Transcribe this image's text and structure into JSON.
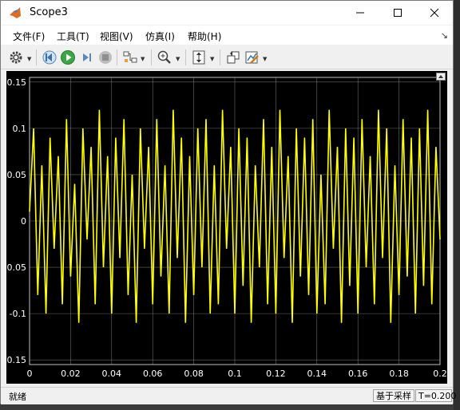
{
  "window": {
    "title": "Scope3"
  },
  "menu": [
    "文件(F)",
    "工具(T)",
    "视图(V)",
    "仿真(I)",
    "帮助(H)"
  ],
  "toolbar_icons": [
    "settings-icon",
    "step-back-icon",
    "run-icon",
    "step-forward-icon",
    "stop-icon",
    "highlight-block-icon",
    "zoom-in-icon",
    "autoscale-icon",
    "restore-layout-icon",
    "edit-style-icon"
  ],
  "status": {
    "ready": "就绪",
    "mode": "基于采样",
    "time": "T=0.200"
  },
  "colors": {
    "trace": "#ffff00",
    "background": "#000000",
    "grid": "#bfbfbf",
    "axis_text": "#ffffff"
  },
  "chart_data": {
    "type": "line",
    "title": "",
    "xlabel": "",
    "ylabel": "",
    "xlim": [
      0,
      0.2
    ],
    "ylim": [
      -0.155,
      0.155
    ],
    "xticks": [
      0,
      0.02,
      0.04,
      0.06,
      0.08,
      0.1,
      0.12,
      0.14,
      0.16,
      0.18,
      0.2
    ],
    "xtick_labels": [
      "0",
      "0.02",
      "0.04",
      "0.06",
      "0.08",
      "0.1",
      "0.12",
      "0.14",
      "0.16",
      "0.18",
      "0.2"
    ],
    "yticks": [
      0.15,
      0.1,
      0.05,
      0,
      -0.05,
      -0.1,
      -0.15
    ],
    "ytick_labels": [
      "0.15",
      "0.1",
      "0.05",
      "0",
      "-0.05",
      "-0.1",
      "-0.15"
    ],
    "grid": true,
    "series": [
      {
        "color": "#ffff00",
        "x": [
          0,
          0.002,
          0.004,
          0.006,
          0.008,
          0.01,
          0.012,
          0.014,
          0.016,
          0.018,
          0.02,
          0.022,
          0.024,
          0.026,
          0.028,
          0.03,
          0.032,
          0.034,
          0.036,
          0.038,
          0.04,
          0.042,
          0.044,
          0.046,
          0.048,
          0.05,
          0.052,
          0.054,
          0.056,
          0.058,
          0.06,
          0.062,
          0.064,
          0.066,
          0.068,
          0.07,
          0.072,
          0.074,
          0.076,
          0.078,
          0.08,
          0.082,
          0.084,
          0.086,
          0.088,
          0.09,
          0.092,
          0.094,
          0.096,
          0.098,
          0.1,
          0.102,
          0.104,
          0.106,
          0.108,
          0.11,
          0.112,
          0.114,
          0.116,
          0.118,
          0.12,
          0.122,
          0.124,
          0.126,
          0.128,
          0.13,
          0.132,
          0.134,
          0.136,
          0.138,
          0.14,
          0.142,
          0.144,
          0.146,
          0.148,
          0.15,
          0.152,
          0.154,
          0.156,
          0.158,
          0.16,
          0.162,
          0.164,
          0.166,
          0.168,
          0.17,
          0.172,
          0.174,
          0.176,
          0.178,
          0.18,
          0.182,
          0.184,
          0.186,
          0.188,
          0.19,
          0.192,
          0.194,
          0.196,
          0.198,
          0.2
        ],
        "y": [
          0.01,
          0.1,
          -0.08,
          0.06,
          -0.1,
          0.09,
          -0.03,
          0.07,
          -0.09,
          0.11,
          -0.06,
          0.04,
          -0.11,
          0.1,
          -0.02,
          0.08,
          -0.09,
          0.12,
          -0.05,
          0.07,
          -0.1,
          0.09,
          -0.04,
          0.11,
          -0.08,
          0.05,
          -0.11,
          0.1,
          -0.03,
          0.08,
          -0.09,
          0.11,
          -0.06,
          0.06,
          -0.1,
          0.12,
          -0.04,
          0.09,
          -0.11,
          0.07,
          -0.08,
          0.1,
          -0.05,
          0.11,
          -0.1,
          0.06,
          -0.09,
          0.12,
          -0.03,
          0.08,
          -0.1,
          0.1,
          -0.07,
          0.09,
          -0.11,
          0.06,
          -0.05,
          0.11,
          -0.09,
          0.08,
          -0.1,
          0.12,
          -0.04,
          0.07,
          -0.11,
          0.1,
          -0.06,
          0.09,
          -0.08,
          0.11,
          -0.1,
          0.05,
          -0.09,
          0.12,
          -0.03,
          0.08,
          -0.11,
          0.1,
          -0.07,
          0.09,
          -0.1,
          0.11,
          -0.05,
          0.07,
          -0.09,
          0.12,
          -0.04,
          0.1,
          -0.11,
          0.06,
          -0.08,
          0.11,
          -0.06,
          0.09,
          -0.1,
          0.1,
          -0.07,
          0.12,
          -0.09,
          0.08,
          -0.02
        ]
      }
    ]
  }
}
